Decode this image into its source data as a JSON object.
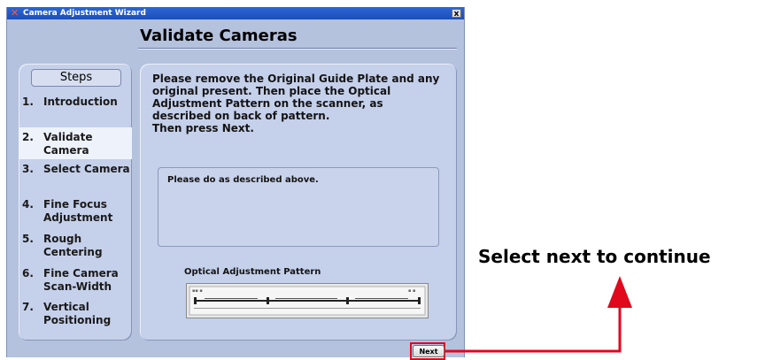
{
  "window": {
    "title": "Camera Adjustment Wizard",
    "close_glyph": "x",
    "page_title": "Validate Cameras"
  },
  "steps": {
    "heading": "Steps",
    "items": [
      {
        "num": "1.",
        "label": "Introduction",
        "active": false
      },
      {
        "num": "2.",
        "label": "Validate Camera",
        "active": true
      },
      {
        "num": "3.",
        "label": "Select Camera",
        "active": false
      },
      {
        "num": "4.",
        "label": "Fine Focus Adjustment",
        "active": false
      },
      {
        "num": "5.",
        "label": "Rough Centering",
        "active": false
      },
      {
        "num": "6.",
        "label": "Fine Camera Scan-Width",
        "active": false
      },
      {
        "num": "7.",
        "label": "Vertical Positioning",
        "active": false
      }
    ]
  },
  "main": {
    "instructions": "Please remove the Original Guide Plate and any original present. Then place the Optical Adjustment Pattern on the scanner, as described on back of pattern.",
    "instructions_line2": "Then press Next.",
    "status": "Please do as described above.",
    "pattern_label": "Optical Adjustment Pattern"
  },
  "footer": {
    "next_label": "Next"
  },
  "annotation": {
    "text": "Select next to continue",
    "color": "#e1081c"
  }
}
